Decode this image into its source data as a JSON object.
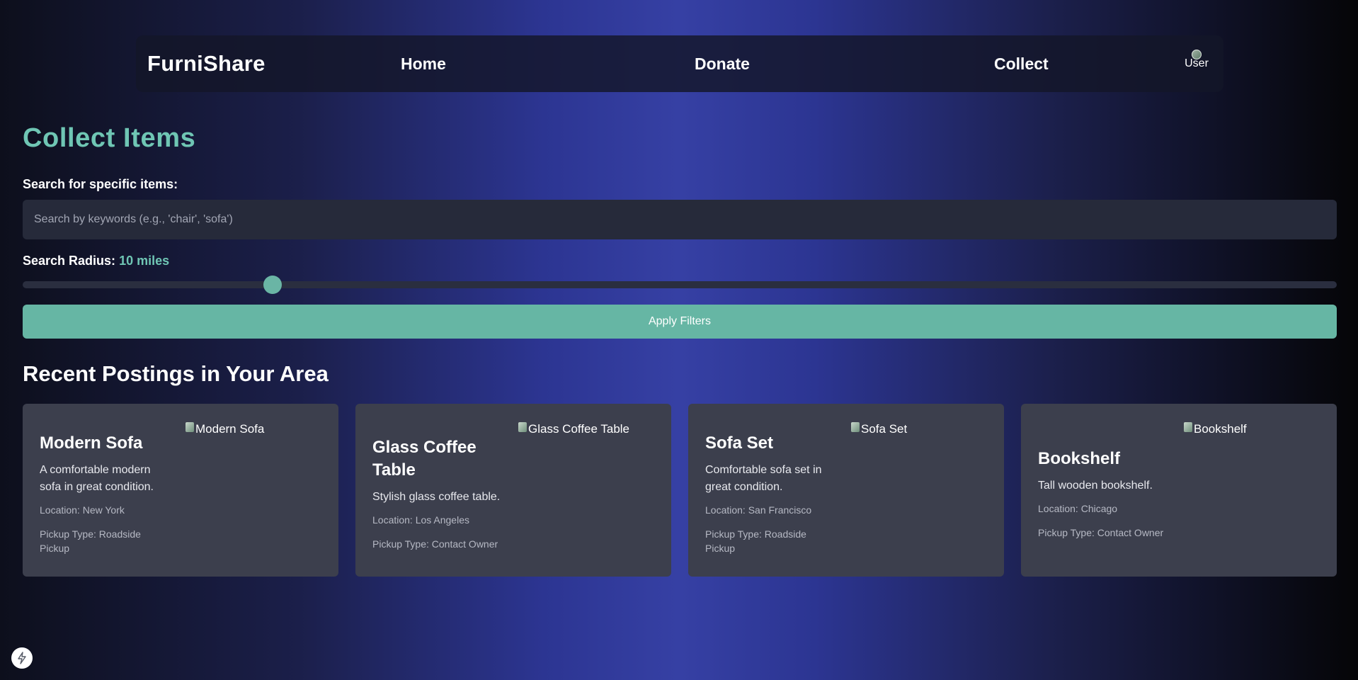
{
  "nav": {
    "brand": "FurniShare",
    "links": [
      "Home",
      "Donate",
      "Collect"
    ],
    "avatar_alt": "User",
    "avatar_icon": "user-avatar-icon"
  },
  "collect": {
    "title": "Collect Items",
    "search_label": "Search for specific items:",
    "search_placeholder": "Search by keywords (e.g., 'chair', 'sofa')",
    "search_value": "",
    "radius_label": "Search Radius:",
    "radius_value": "10 miles",
    "radius_fraction": 0.19,
    "apply_label": "Apply Filters"
  },
  "postings": {
    "title": "Recent Postings in Your Area",
    "items": [
      {
        "name": "Modern Sofa",
        "description": "A comfortable modern sofa in great condition.",
        "location": "Location: New York",
        "pickup": "Pickup Type: Roadside Pickup",
        "image_alt": "Modern Sofa"
      },
      {
        "name": "Glass Coffee Table",
        "description": "Stylish glass coffee table.",
        "location": "Location: Los Angeles",
        "pickup": "Pickup Type: Contact Owner",
        "image_alt": "Glass Coffee Table"
      },
      {
        "name": "Sofa Set",
        "description": "Comfortable sofa set in great condition.",
        "location": "Location: San Francisco",
        "pickup": "Pickup Type: Roadside Pickup",
        "image_alt": "Sofa Set"
      },
      {
        "name": "Bookshelf",
        "description": "Tall wooden bookshelf.",
        "location": "Location: Chicago",
        "pickup": "Pickup Type: Contact Owner",
        "image_alt": "Bookshelf"
      }
    ]
  },
  "colors": {
    "accent": "#6fc6b4",
    "button": "#66b6a4",
    "card": "#3c3f4d",
    "input": "#262a3a"
  },
  "floating_icon": "bolt-icon"
}
